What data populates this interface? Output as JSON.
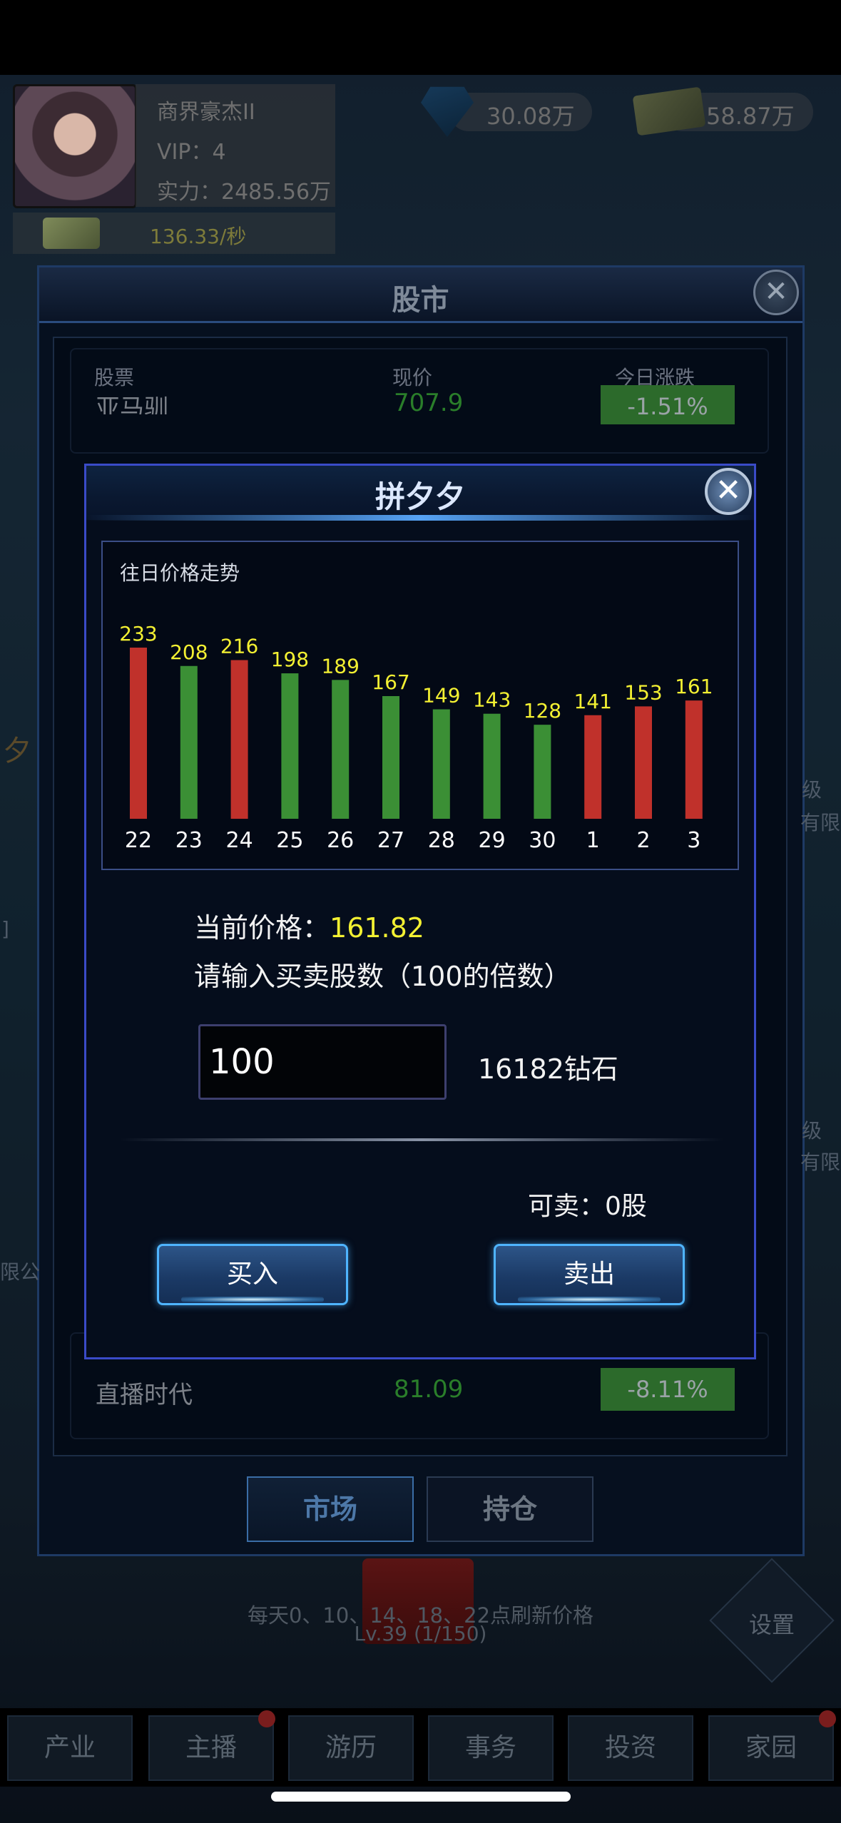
{
  "profile": {
    "name": "商界豪杰II",
    "vip": "VIP：4",
    "power": "实力：2485.56万",
    "income_rate": "136.33/秒"
  },
  "resources": {
    "diamonds": "30.08万",
    "cash": "58.87万"
  },
  "market": {
    "title": "股市",
    "columns": [
      "股票",
      "现价",
      "今日涨跌"
    ],
    "rows": [
      {
        "name": "亚马驯",
        "price": "707.9",
        "change": "-1.51%"
      },
      {
        "name": "直播时代",
        "price": "81.09",
        "change": "-8.11%"
      }
    ],
    "tabs": {
      "market": "市场",
      "holdings": "持仓"
    },
    "refresh_note": "每天0、10、14、18、22点刷新价格",
    "level": "Lv.39 (1/150)",
    "settings_label": "设置",
    "side_fragments": [
      "级",
      "有限",
      "]",
      "级",
      "有限",
      "限公",
      "夕"
    ]
  },
  "dialog": {
    "title": "拼夕夕",
    "chart_title": "往日价格走势",
    "price_label": "当前价格：",
    "price_value": "161.82",
    "qty_prompt": "请输入买卖股数（100的倍数）",
    "qty_value": "100",
    "cost_text": "16182钻石",
    "sellable_text": "可卖：0股",
    "buy_label": "买入",
    "sell_label": "卖出"
  },
  "chart_data": {
    "type": "bar",
    "title": "往日价格走势",
    "categories": [
      "22",
      "23",
      "24",
      "25",
      "26",
      "27",
      "28",
      "29",
      "30",
      "1",
      "2",
      "3"
    ],
    "values": [
      233,
      208,
      216,
      198,
      189,
      167,
      149,
      143,
      128,
      141,
      153,
      161
    ],
    "bar_colors": [
      "#c0312b",
      "#3b8f35",
      "#c0312b",
      "#3b8f35",
      "#3b8f35",
      "#3b8f35",
      "#3b8f35",
      "#3b8f35",
      "#3b8f35",
      "#c0312b",
      "#c0312b",
      "#c0312b"
    ],
    "value_label_color": "#f3f032",
    "axis_label_color": "#ffffff"
  },
  "nav": {
    "items": [
      "产业",
      "主播",
      "游历",
      "事务",
      "投资",
      "家园"
    ]
  },
  "colors": {
    "rise": "#c0312b",
    "fall": "#3b8f35",
    "highlight": "#f3f032",
    "dialog_border": "#3a4bc8"
  }
}
